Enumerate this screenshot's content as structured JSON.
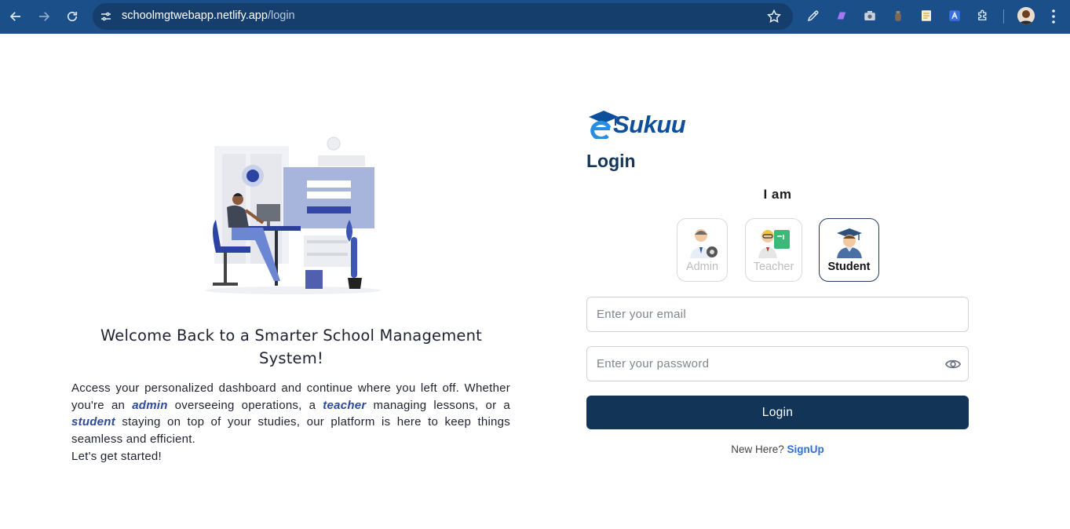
{
  "browser": {
    "url_host": "schoolmgtwebapp.netlify.app",
    "url_path": "/login"
  },
  "welcome": {
    "title_line1": "Welcome Back to a Smarter School Management",
    "title_line2": "System!",
    "desc_part1": "Access your personalized dashboard and continue where you left off. Whether you're an ",
    "desc_admin": "admin",
    "desc_part2": " overseeing operations, a ",
    "desc_teacher": "teacher",
    "desc_part3": " managing lessons, or a ",
    "desc_student": "student",
    "desc_part4": " staying on top of your studies, our platform is here to keep things seamless and efficient.",
    "desc_last": "Let's get started!"
  },
  "brand": {
    "name": "Sukuu",
    "color": "#0d4f9b"
  },
  "login": {
    "title": "Login",
    "iam": "I am",
    "roles": [
      {
        "label": "Admin",
        "active": false
      },
      {
        "label": "Teacher",
        "active": false
      },
      {
        "label": "Student",
        "active": true
      }
    ],
    "email_placeholder": "Enter your email",
    "password_placeholder": "Enter your password",
    "button_label": "Login",
    "new_here": "New Here?",
    "signup_label": "SignUp",
    "button_color": "#123456",
    "link_color": "#2f6fd0"
  }
}
